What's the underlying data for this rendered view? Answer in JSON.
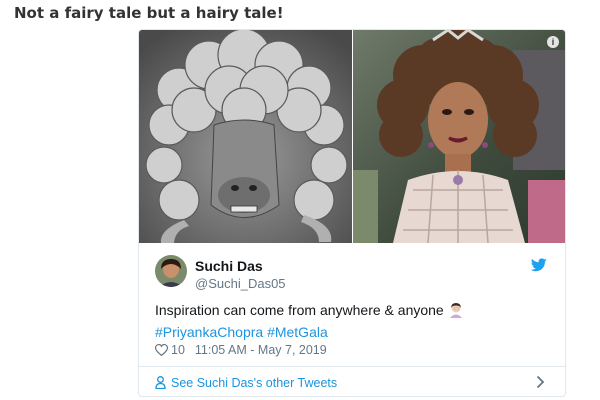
{
  "headline": "Not a fairy tale but a hairy tale!",
  "tweet": {
    "author_name": "Suchi Das",
    "author_handle": "@Suchi_Das05",
    "text_line1": "Inspiration can come from anywhere & anyone",
    "hashtags": [
      "#PriyankaChopra",
      "#MetGala"
    ],
    "likes": "10",
    "timestamp": "11:05 AM - May 7, 2019",
    "footer_link": "See Suchi Das's other Tweets",
    "info_glyph": "i",
    "media": [
      {
        "icon": "sheep-photo"
      },
      {
        "icon": "woman-curly-hair-photo"
      }
    ]
  },
  "colors": {
    "link": "#1b95e0",
    "muted": "#657786",
    "text": "#14171a",
    "border": "#e1e8ed",
    "twitter_blue": "#1da1f2"
  }
}
